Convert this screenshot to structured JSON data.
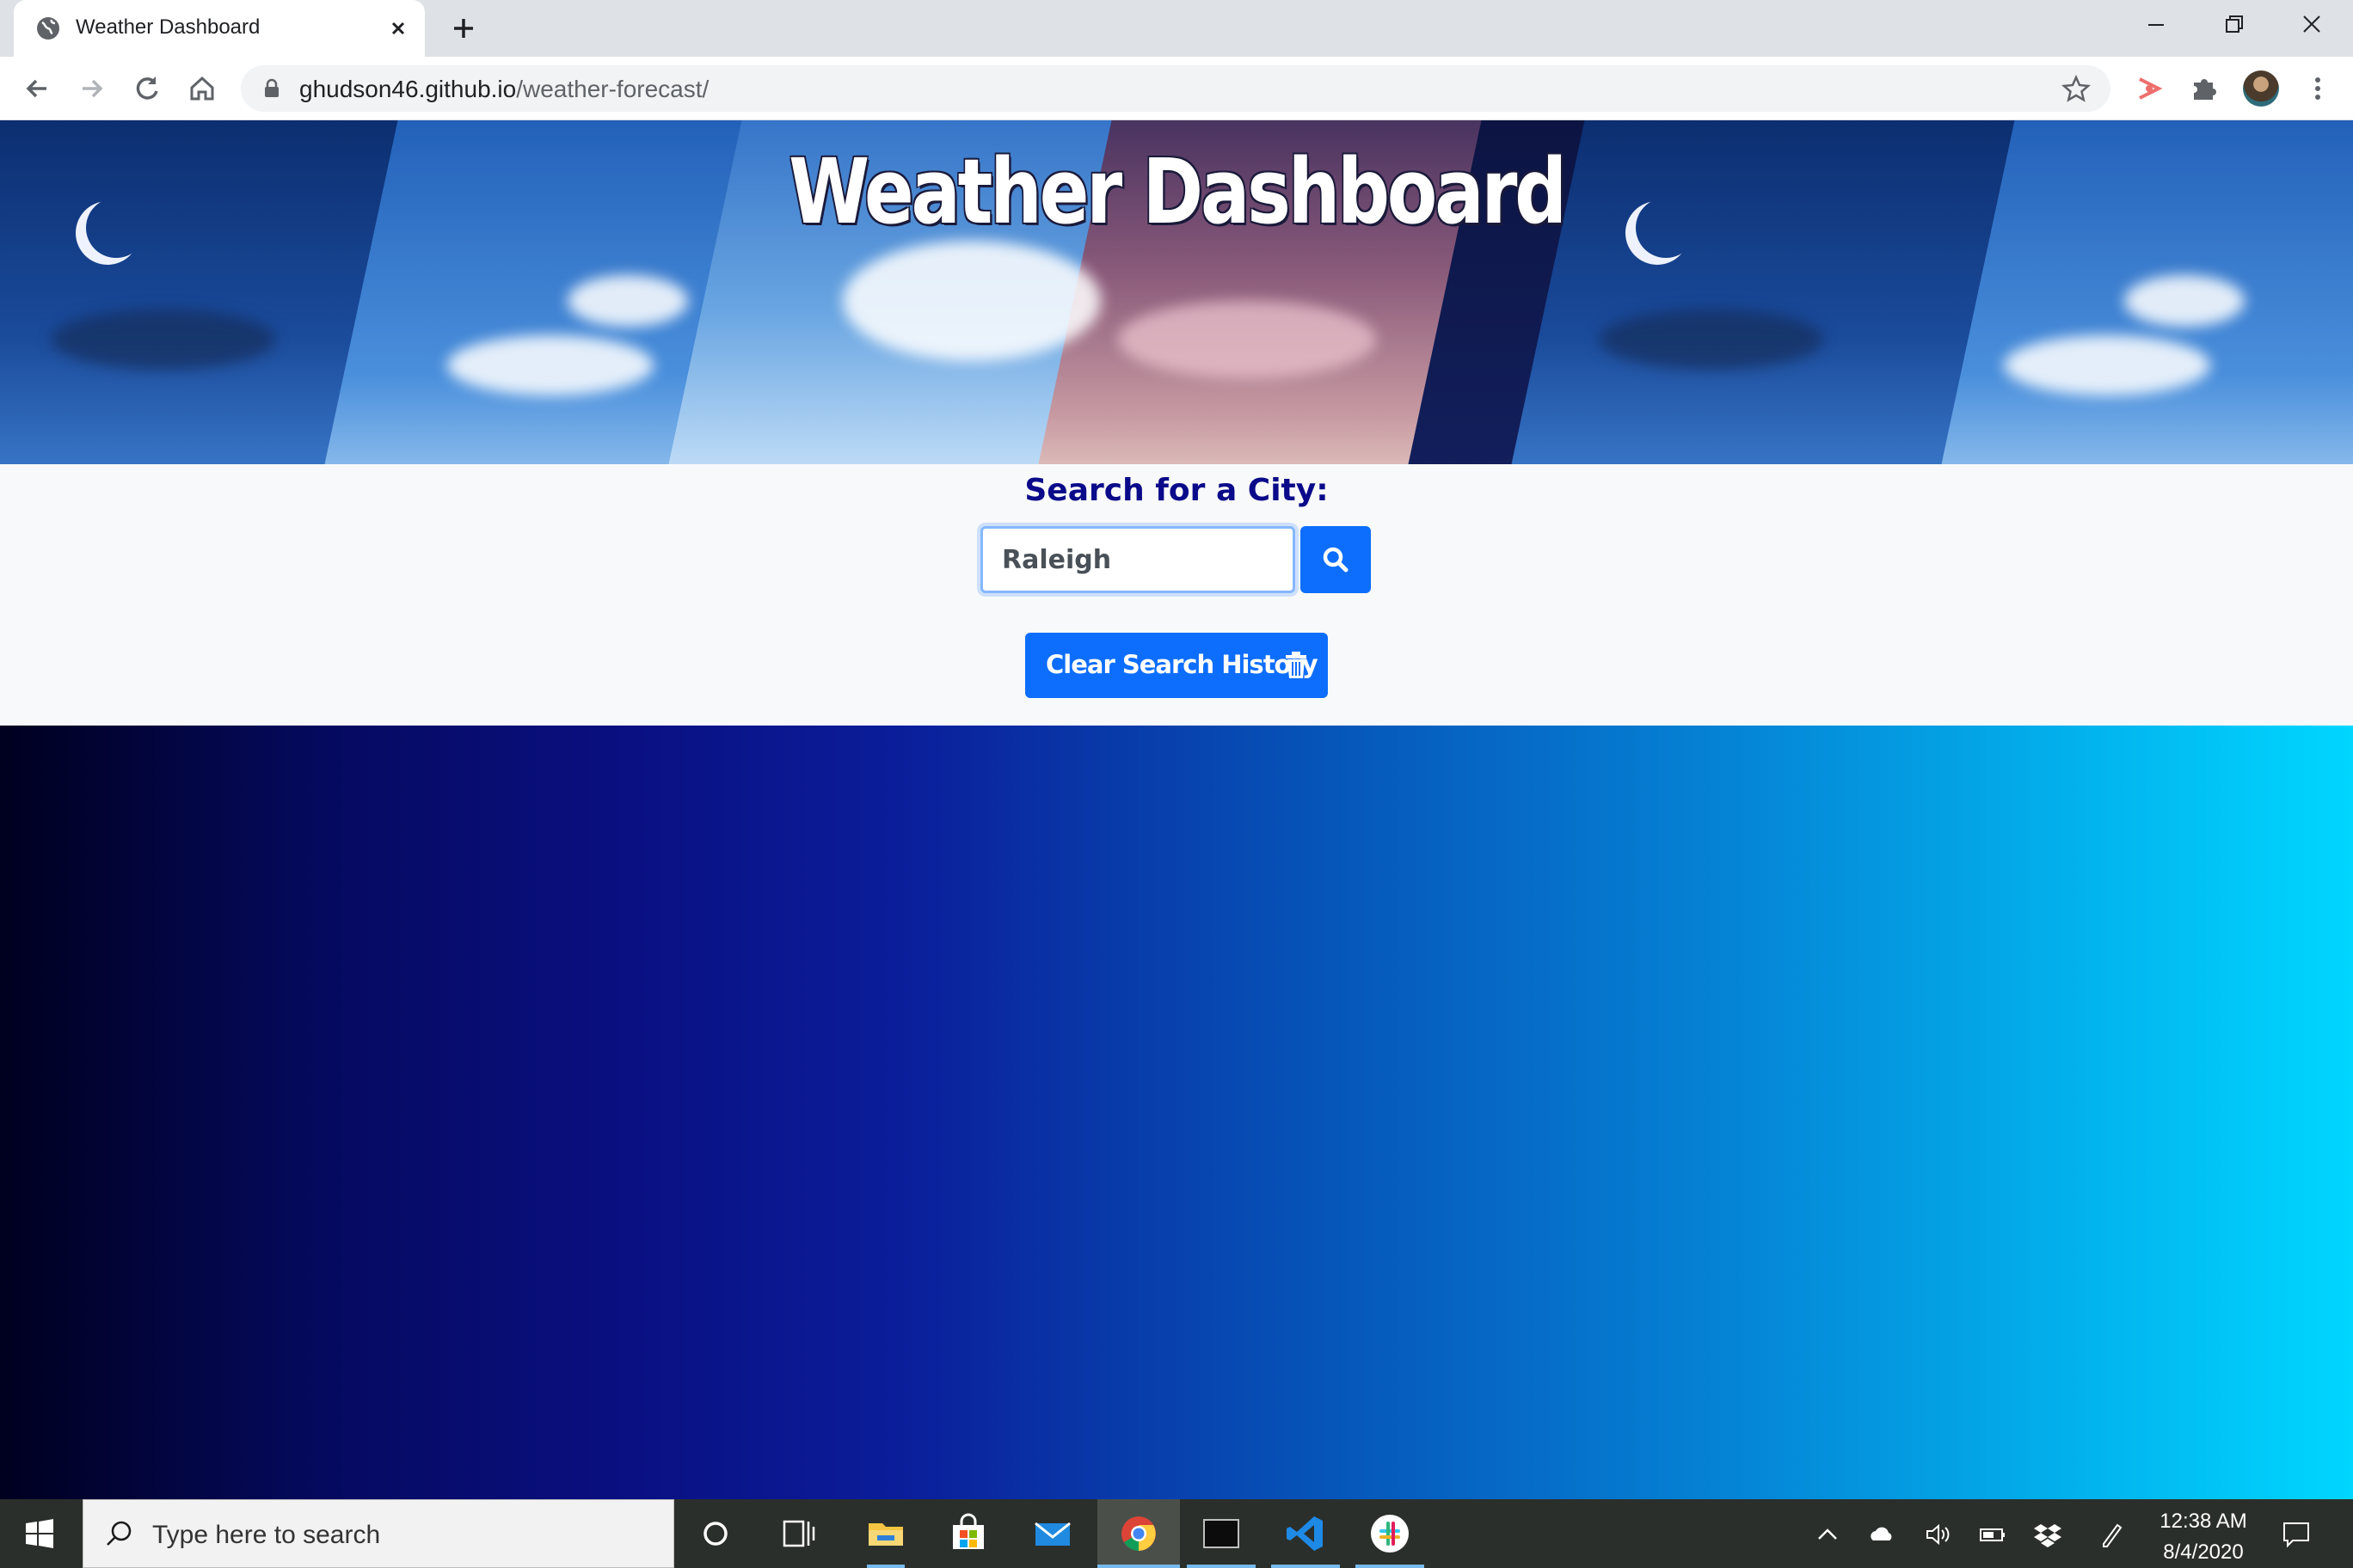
{
  "browser": {
    "tab_title": "Weather Dashboard",
    "url_domain": "ghudson46.github.io",
    "url_path": "/weather-forecast/"
  },
  "page": {
    "title": "Weather Dashboard",
    "search_heading": "Search for a City:",
    "search_value": "Raleigh",
    "clear_button_label": "Clear Search History",
    "accent_color": "#0d6efd",
    "heading_color": "#0a0a8a"
  },
  "taskbar": {
    "search_placeholder": "Type here to search",
    "time": "12:38 AM",
    "date": "8/4/2020"
  },
  "icons": [
    "globe-icon",
    "close-icon",
    "plus-icon",
    "back-icon",
    "forward-icon",
    "reload-icon",
    "home-icon",
    "lock-icon",
    "star-icon",
    "extension-icon",
    "puzzle-icon",
    "menu-icon",
    "search-icon",
    "trash-icon",
    "windows-icon",
    "cortana-icon",
    "task-view-icon",
    "file-explorer-icon",
    "store-icon",
    "mail-icon",
    "chrome-icon",
    "terminal-icon",
    "vscode-icon",
    "slack-icon",
    "chevron-up-icon",
    "onedrive-icon",
    "volume-icon",
    "battery-icon",
    "dropbox-icon",
    "pen-icon",
    "notification-icon"
  ]
}
